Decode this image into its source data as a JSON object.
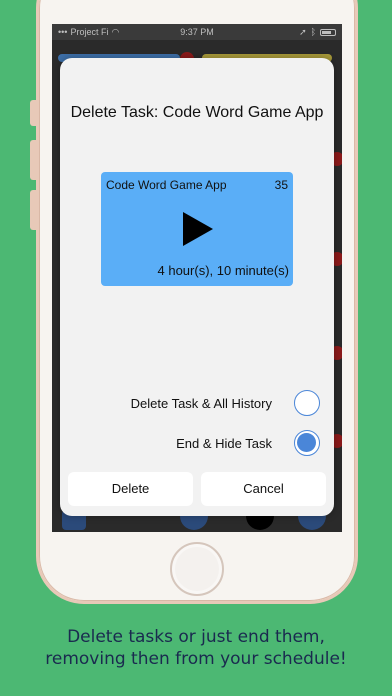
{
  "status_bar": {
    "carrier": "Project Fi",
    "time": "9:37 PM"
  },
  "dialog": {
    "title": "Delete Task: Code Word Game App",
    "task_card": {
      "name": "Code Word Game App",
      "count": "35",
      "duration": "4 hour(s), 10 minute(s)",
      "color": "#5aaef7"
    },
    "options": [
      {
        "label": "Delete Task & All History",
        "selected": false
      },
      {
        "label": "End & Hide Task",
        "selected": true
      }
    ],
    "delete_label": "Delete",
    "cancel_label": "Cancel"
  },
  "caption": {
    "line1": "Delete tasks or just end them,",
    "line2": "removing then from your schedule!"
  },
  "colors": {
    "background": "#4cb873",
    "accent": "#4a86d8"
  }
}
